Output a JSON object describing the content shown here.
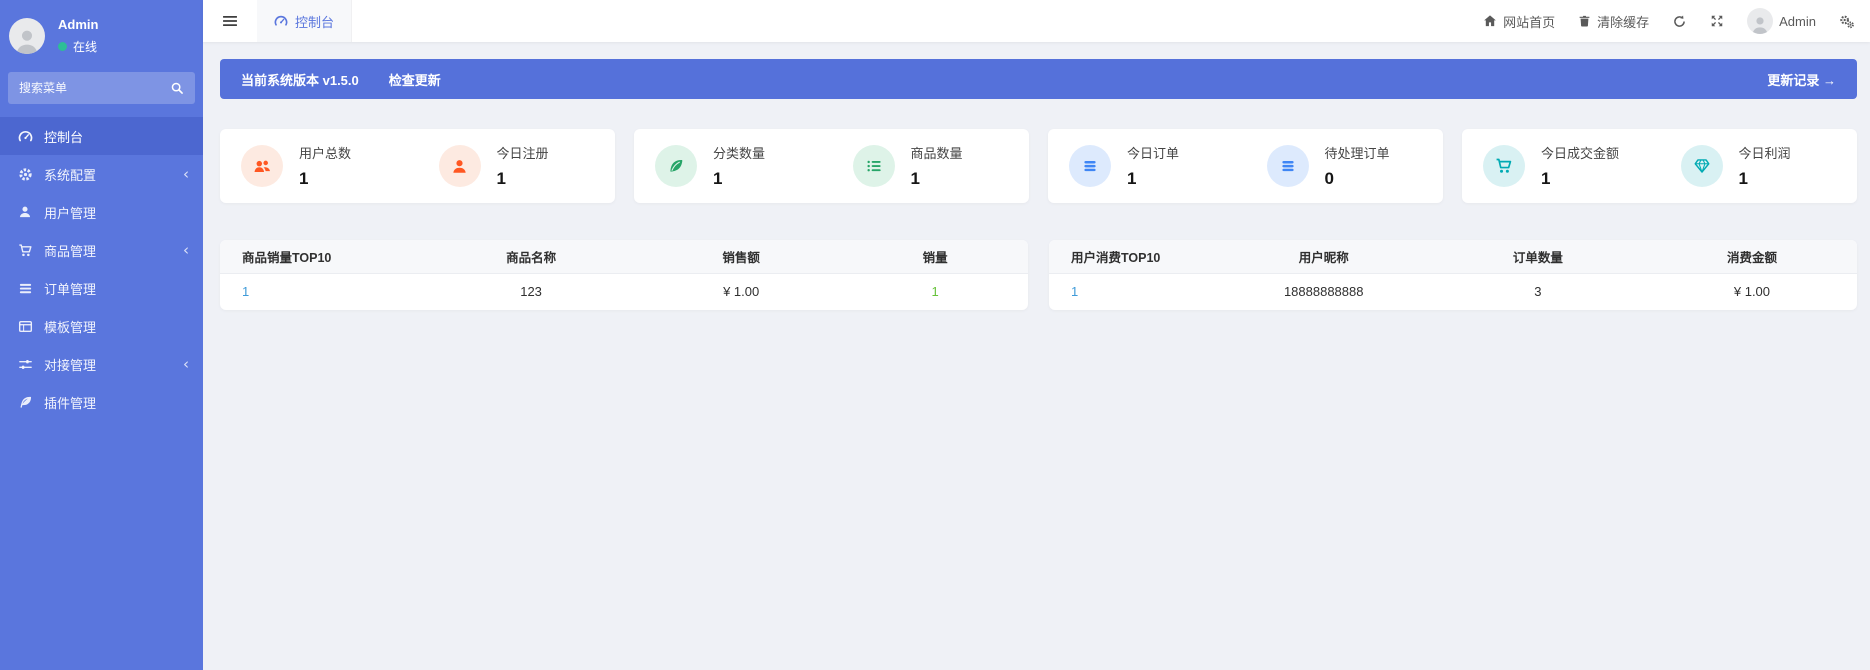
{
  "colors": {
    "sidebar": "#5a76dd",
    "sidebar_active": "#4c67d0",
    "banner": "#5571da",
    "content_bg": "#eff1f6",
    "online_dot": "#2dbd96",
    "rank_link": "#3f9bd9",
    "qty_green": "#67c23a",
    "stat_orange": "#ff5722",
    "stat_green": "#27a568",
    "stat_blue": "#3f86f5",
    "stat_teal": "#00aab3"
  },
  "sidebar": {
    "profile": {
      "name": "Admin",
      "status": "在线"
    },
    "search": {
      "placeholder": "搜索菜单"
    },
    "chevron_glyph": "‹",
    "items": [
      {
        "label": "控制台",
        "icon": "tachometer-icon",
        "active": true
      },
      {
        "label": "系统配置",
        "icon": "gear-icon",
        "chevron": true
      },
      {
        "label": "用户管理",
        "icon": "user-icon"
      },
      {
        "label": "商品管理",
        "icon": "cart-icon",
        "chevron": true
      },
      {
        "label": "订单管理",
        "icon": "list-icon"
      },
      {
        "label": "模板管理",
        "icon": "template-icon"
      },
      {
        "label": "对接管理",
        "icon": "sliders-icon",
        "chevron": true
      },
      {
        "label": "插件管理",
        "icon": "feather-icon"
      }
    ]
  },
  "topbar": {
    "tab": {
      "label": "控制台",
      "icon": "tachometer-icon"
    },
    "home_label": "网站首页",
    "clear_cache_label": "清除缓存",
    "username": "Admin"
  },
  "banner": {
    "version_text": "当前系统版本 v1.5.0",
    "check_update_label": "检查更新",
    "changelog_label": "更新记录 →"
  },
  "stats": [
    {
      "label": "用户总数",
      "value": "1",
      "icon": "users-icon",
      "color": "#ff5722",
      "bg": "#fdeae1"
    },
    {
      "label": "今日注册",
      "value": "1",
      "icon": "user-icon",
      "color": "#ff5722",
      "bg": "#fdeae1"
    },
    {
      "label": "分类数量",
      "value": "1",
      "icon": "leaf-icon",
      "color": "#27a568",
      "bg": "#def3e8"
    },
    {
      "label": "商品数量",
      "value": "1",
      "icon": "list-check-icon",
      "color": "#27a568",
      "bg": "#def3e8"
    },
    {
      "label": "今日订单",
      "value": "1",
      "icon": "bars-icon",
      "color": "#3f86f5",
      "bg": "#ddeafd"
    },
    {
      "label": "待处理订单",
      "value": "0",
      "icon": "bars-icon",
      "color": "#3f86f5",
      "bg": "#ddeafd"
    },
    {
      "label": "今日成交金额",
      "value": "1",
      "icon": "cart-icon",
      "color": "#00aab3",
      "bg": "#d9f1f3"
    },
    {
      "label": "今日利润",
      "value": "1",
      "icon": "gem-icon",
      "color": "#00aab3",
      "bg": "#d9f1f3"
    }
  ],
  "tables": [
    {
      "headers": [
        "商品销量TOP10",
        "商品名称",
        "销售额",
        "销量"
      ],
      "rows": [
        [
          "1",
          "123",
          "¥ 1.00",
          "1"
        ]
      ]
    },
    {
      "headers": [
        "用户消费TOP10",
        "用户昵称",
        "订单数量",
        "消费金额"
      ],
      "rows": [
        [
          "1",
          "18888888888",
          "3",
          "¥ 1.00"
        ]
      ]
    }
  ]
}
